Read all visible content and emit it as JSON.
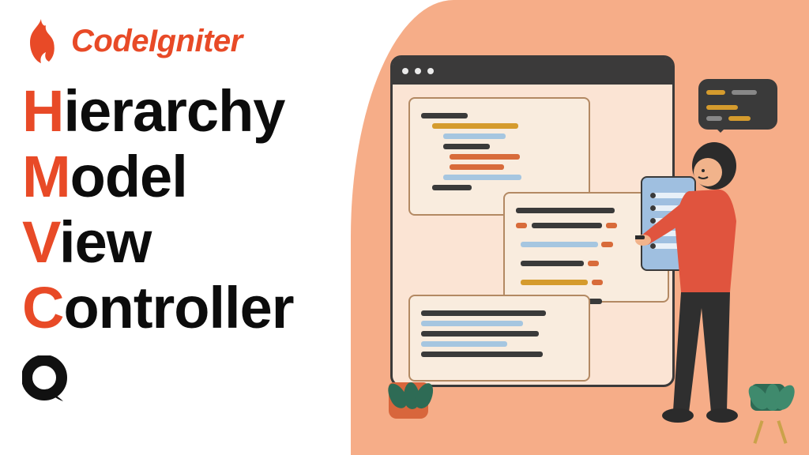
{
  "brand": {
    "name": "CodeIgniter"
  },
  "terms": [
    {
      "initial": "H",
      "rest": "ierarchy"
    },
    {
      "initial": "M",
      "rest": "odel"
    },
    {
      "initial": "V",
      "rest": "iew"
    },
    {
      "initial": "C",
      "rest": "ontroller"
    }
  ],
  "colors": {
    "accent": "#e84a27",
    "peach": "#f6ad88",
    "text": "#0c0c0c"
  },
  "icons": {
    "flame": "flame-icon",
    "bottom_logo": "q-logo-icon",
    "speech": "speech-bubble"
  }
}
